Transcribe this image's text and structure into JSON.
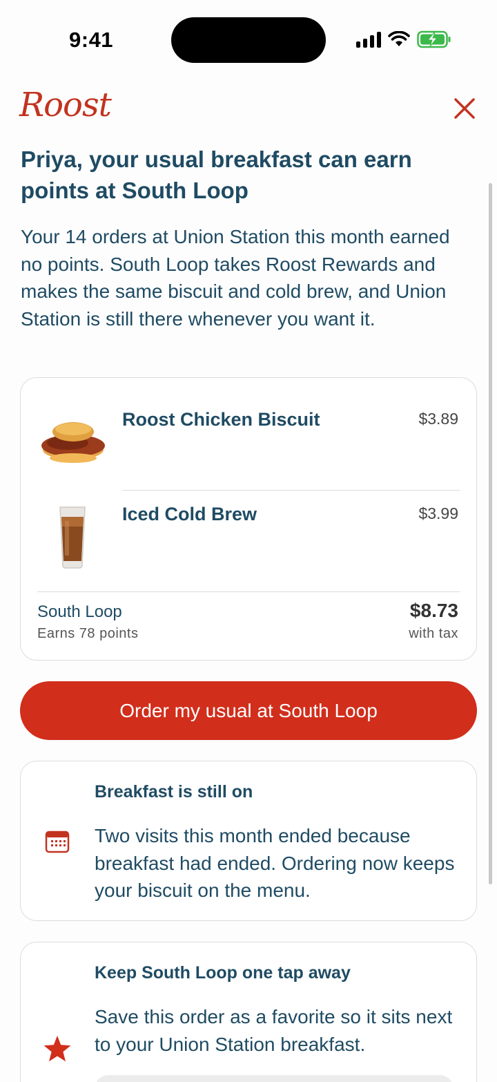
{
  "status_bar": {
    "time": "9:41"
  },
  "header": {
    "logo": "Roost",
    "close_icon": "close-icon"
  },
  "headline": "Priya, your usual breakfast can earn points at South Loop",
  "intro": "Your 14 orders at Union Station this month earned no points. South Loop takes Roost Rewards and makes the same biscuit and cold brew, and Union Station is still there whenever you want it.",
  "order": {
    "items": [
      {
        "name": "Roost Chicken Biscuit",
        "price": "$3.89",
        "icon": "chicken-biscuit-image"
      },
      {
        "name": "Iced Cold Brew",
        "price": "$3.99",
        "icon": "iced-cold-brew-image"
      }
    ],
    "location": "South Loop",
    "points": "Earns 78 points",
    "total": "$8.73",
    "total_note": "with tax"
  },
  "cta_label": "Order my usual at South Loop",
  "cards": [
    {
      "title": "Breakfast is still on",
      "body": "Two visits this month ended because breakfast had ended. Ordering now keeps your biscuit on the menu.",
      "icon": "calendar-icon"
    },
    {
      "title": "Keep South Loop one tap away",
      "body": "Save this order as a favorite so it sits next to your Union Station breakfast.",
      "icon": "star-icon"
    }
  ],
  "colors": {
    "brand_red": "#d12e1c",
    "text_navy": "#1f4b63"
  }
}
